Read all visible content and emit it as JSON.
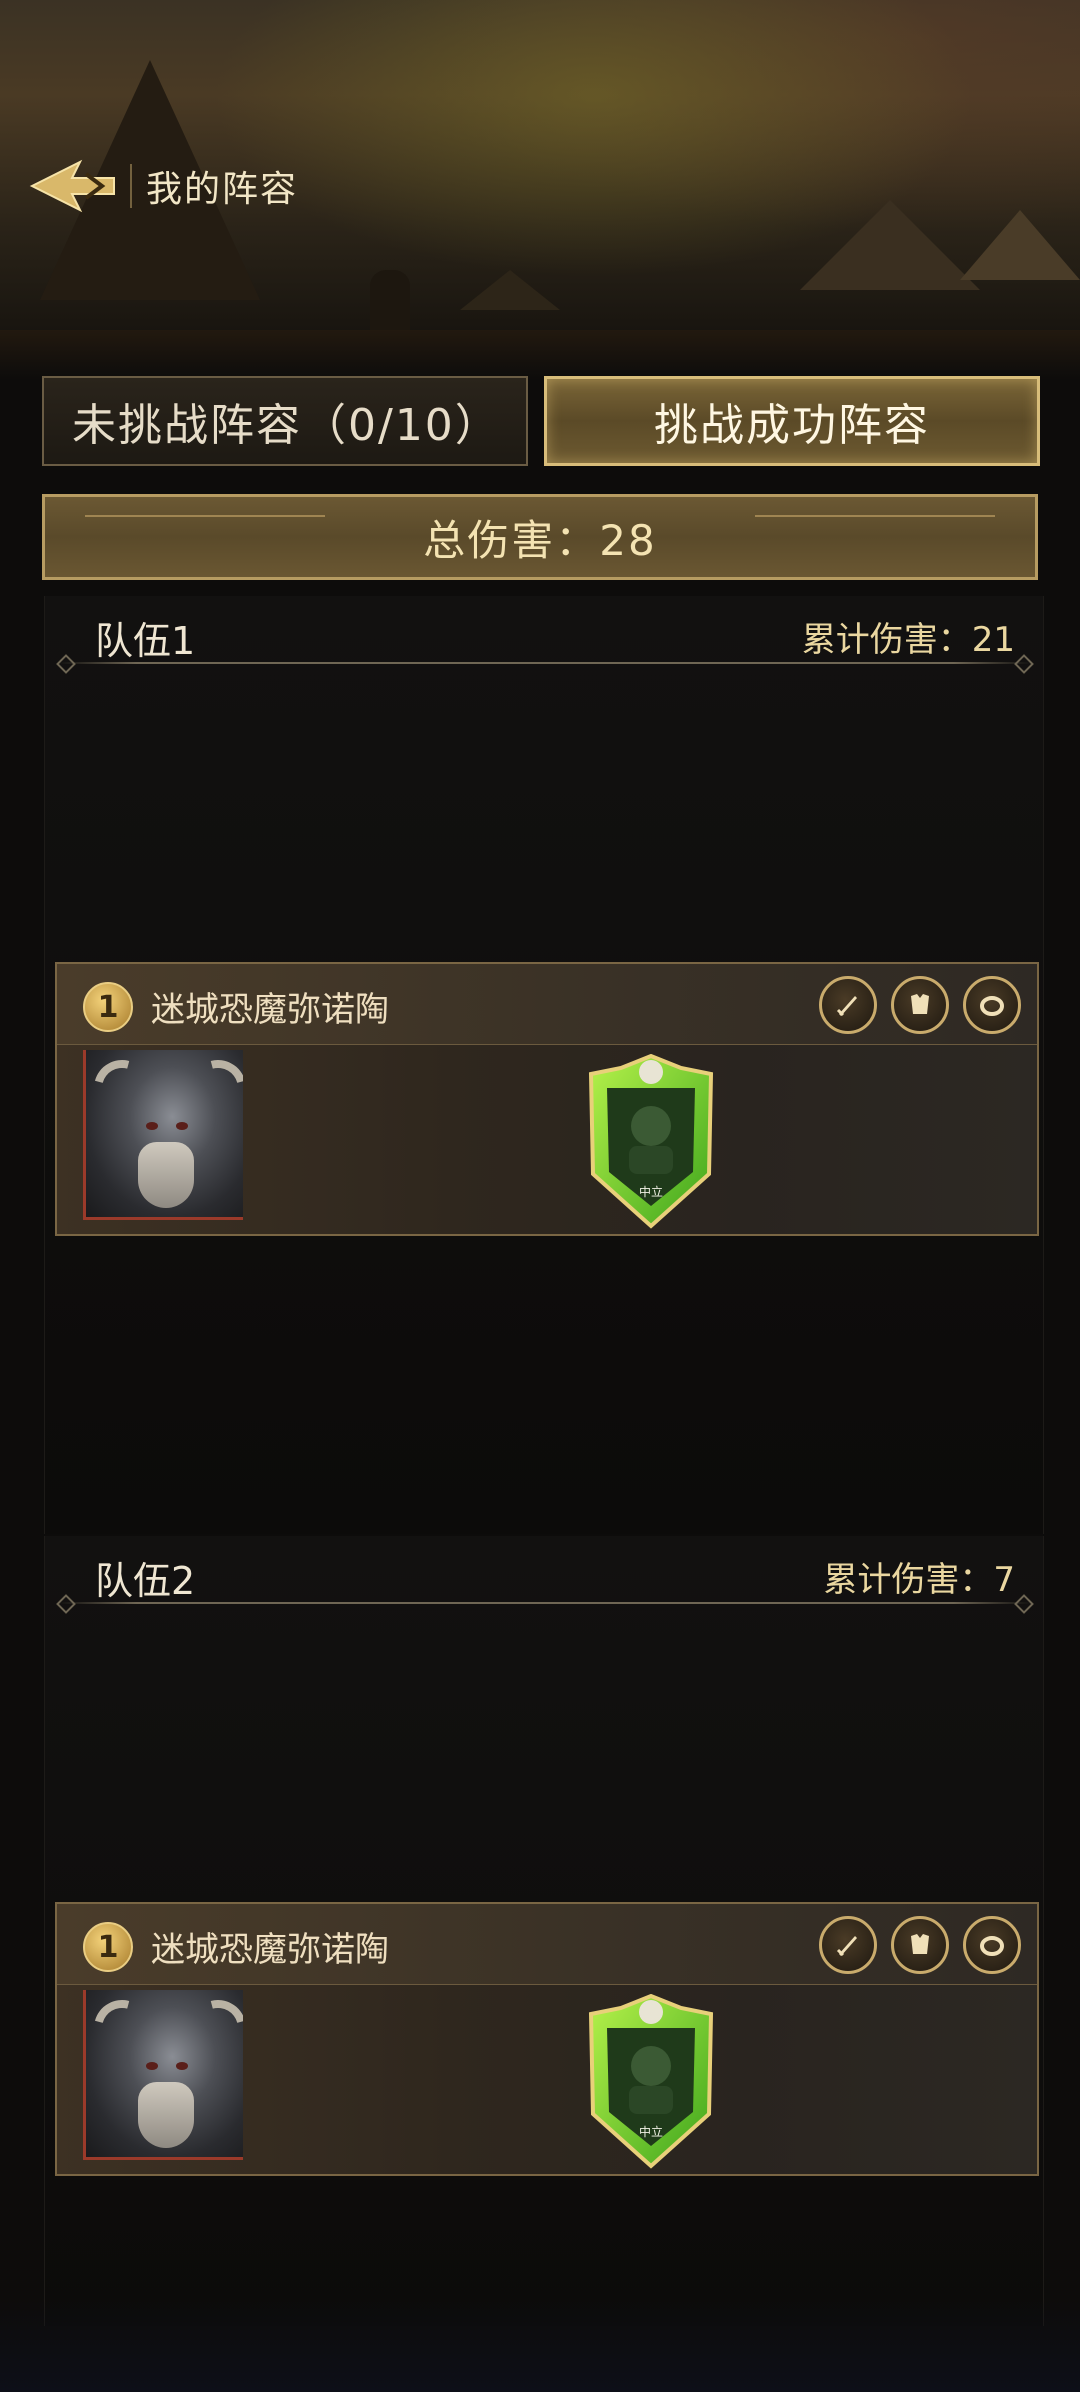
{
  "header": {
    "title": "我的阵容"
  },
  "tabs": [
    {
      "label": "未挑战阵容（0/10）",
      "active": false
    },
    {
      "label": "挑战成功阵容",
      "active": true
    }
  ],
  "total_damage": "总伤害：28",
  "teams": [
    {
      "name": "队伍1",
      "cumulative_damage": "累计伤害：21",
      "heroes": [
        {
          "level": "1",
          "name": "迷城恐魔弥诺陶",
          "faction": "中立",
          "equipment": [
            "sword-icon",
            "armor-icon",
            "ring-icon"
          ]
        }
      ]
    },
    {
      "name": "队伍2",
      "cumulative_damage": "累计伤害：7",
      "heroes": [
        {
          "level": "1",
          "name": "迷城恐魔弥诺陶",
          "faction": "中立",
          "equipment": [
            "sword-icon",
            "armor-icon",
            "ring-icon"
          ]
        }
      ]
    }
  ],
  "colors": {
    "gold": "#d8bd7a",
    "panel_bg": "#0d0c0b",
    "emblem_green": "#4fd32a"
  }
}
